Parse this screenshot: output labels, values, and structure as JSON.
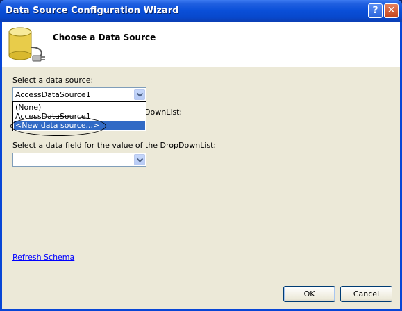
{
  "window": {
    "title": "Data Source Configuration Wizard",
    "help_label": "?",
    "close_label": "✕"
  },
  "header": {
    "title": "Choose a Data Source"
  },
  "data_source": {
    "label": "Select a data source:",
    "selected": "AccessDataSource1",
    "options": [
      "(None)",
      "AccessDataSource1",
      "<New data source...>"
    ],
    "highlighted_option": "<New data source...>"
  },
  "display_field": {
    "label_visible_fragment": "DownList:"
  },
  "value_field": {
    "label": "Select a data field for the value of the DropDownList:",
    "selected": ""
  },
  "refresh_link": "Refresh Schema",
  "buttons": {
    "ok": "OK",
    "cancel": "Cancel"
  }
}
